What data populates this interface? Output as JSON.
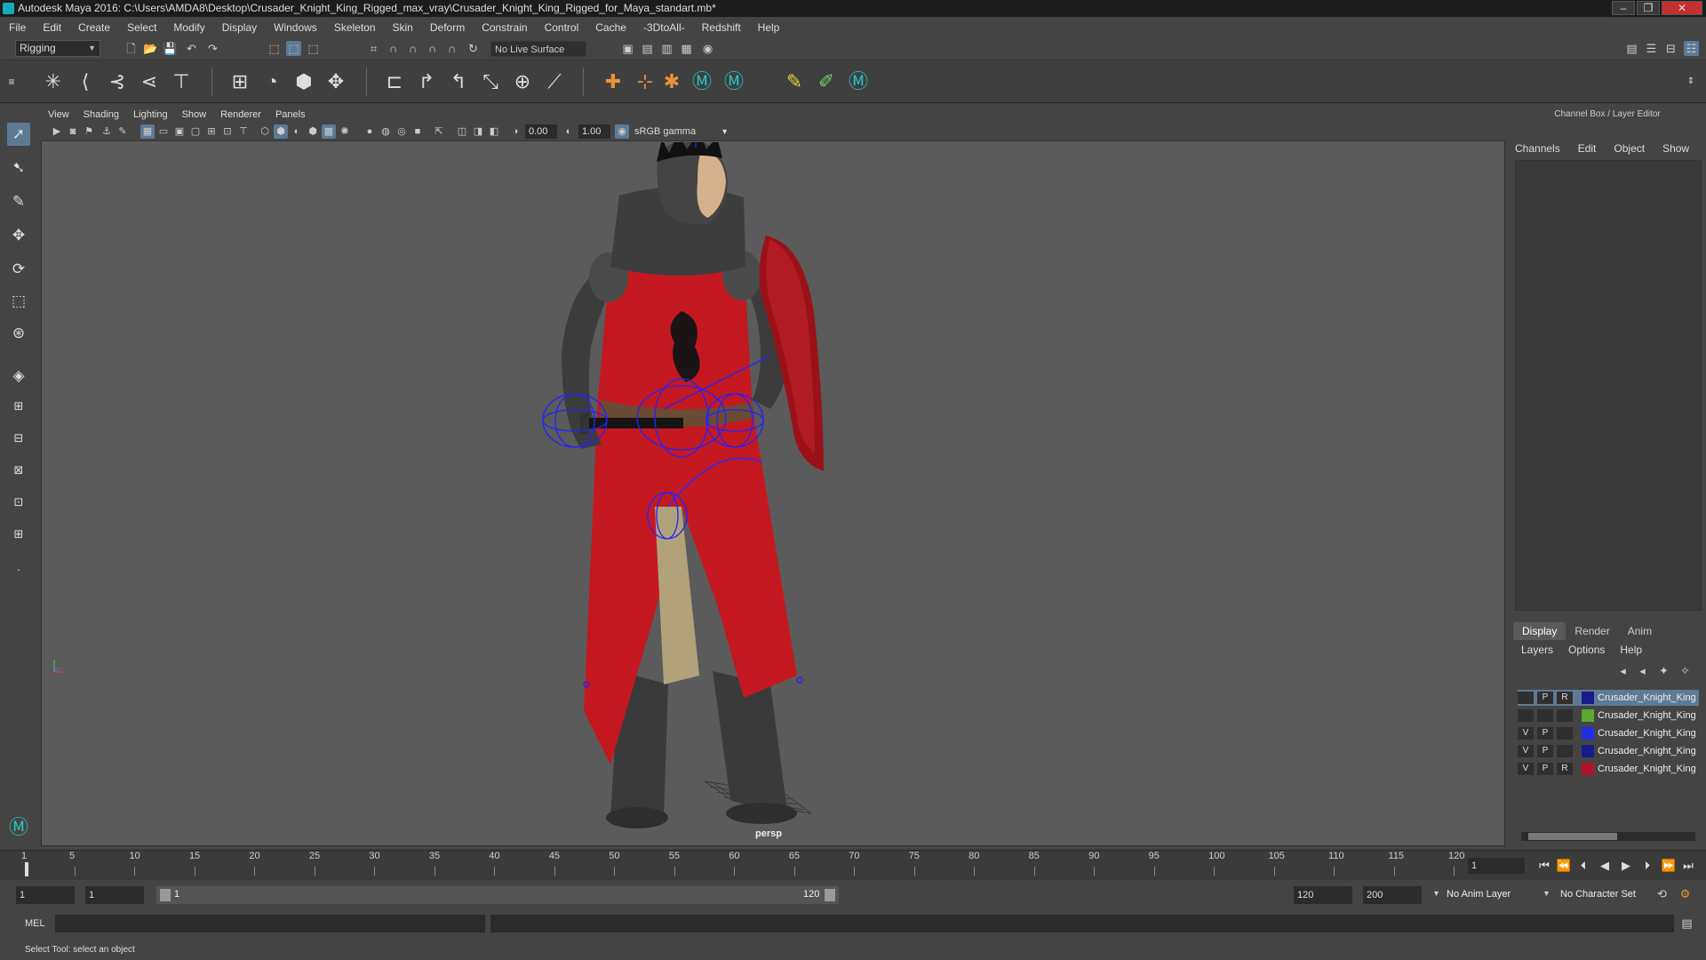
{
  "window": {
    "title": "Autodesk Maya 2016: C:\\Users\\AMDA8\\Desktop\\Crusader_Knight_King_Rigged_max_vray\\Crusader_Knight_King_Rigged_for_Maya_standart.mb*",
    "minimize": "–",
    "maximize": "❐",
    "close": "✕"
  },
  "menubar": {
    "items": [
      "File",
      "Edit",
      "Create",
      "Select",
      "Modify",
      "Display",
      "Windows",
      "Skeleton",
      "Skin",
      "Deform",
      "Constrain",
      "Control",
      "Cache",
      "-3DtoAll-",
      "Redshift",
      "Help"
    ]
  },
  "statusline": {
    "mode": "Rigging",
    "live_surface": "No Live Surface"
  },
  "viewport": {
    "menus": [
      "View",
      "Shading",
      "Lighting",
      "Show",
      "Renderer",
      "Panels"
    ],
    "exposure": "0.00",
    "gamma": "1.00",
    "color_space": "sRGB gamma",
    "camera": "persp"
  },
  "channelbox": {
    "title": "Channel Box / Layer Editor",
    "tabs": [
      "Channels",
      "Edit",
      "Object",
      "Show"
    ]
  },
  "layer_editor": {
    "tabs": [
      "Display",
      "Render",
      "Anim"
    ],
    "active_tab": "Display",
    "menus": [
      "Layers",
      "Options",
      "Help"
    ],
    "layers": [
      {
        "v": "",
        "p": "P",
        "r": "R",
        "color": "#1a1a8c",
        "name": "Crusader_Knight_King",
        "selected": true
      },
      {
        "v": "",
        "p": "",
        "r": "",
        "color": "#5aa832",
        "name": "Crusader_Knight_King",
        "selected": false
      },
      {
        "v": "V",
        "p": "P",
        "r": "",
        "color": "#1f2fe6",
        "name": "Crusader_Knight_King",
        "selected": false
      },
      {
        "v": "V",
        "p": "P",
        "r": "",
        "color": "#141c8a",
        "name": "Crusader_Knight_King",
        "selected": false
      },
      {
        "v": "V",
        "p": "P",
        "r": "R",
        "color": "#b0142a",
        "name": "Crusader_Knight_King",
        "selected": false
      }
    ]
  },
  "timeslider": {
    "ticks": [
      "1",
      "5",
      "10",
      "15",
      "20",
      "25",
      "30",
      "35",
      "40",
      "45",
      "50",
      "55",
      "60",
      "65",
      "70",
      "75",
      "80",
      "85",
      "90",
      "95",
      "100",
      "105",
      "110",
      "115",
      "120"
    ],
    "current_time": "1"
  },
  "range": {
    "start": "1",
    "playback_start": "1",
    "slider_start": "1",
    "slider_end": "120",
    "playback_end": "120",
    "end": "200",
    "anim_layer": "No Anim Layer",
    "character_set": "No Character Set"
  },
  "cmdline": {
    "label": "MEL"
  },
  "helpline": {
    "text": "Select Tool: select an object"
  },
  "colors": {
    "accent": "#5d7a95",
    "viewport_bg": "#5b5b5b",
    "panel_bg": "#444444"
  }
}
